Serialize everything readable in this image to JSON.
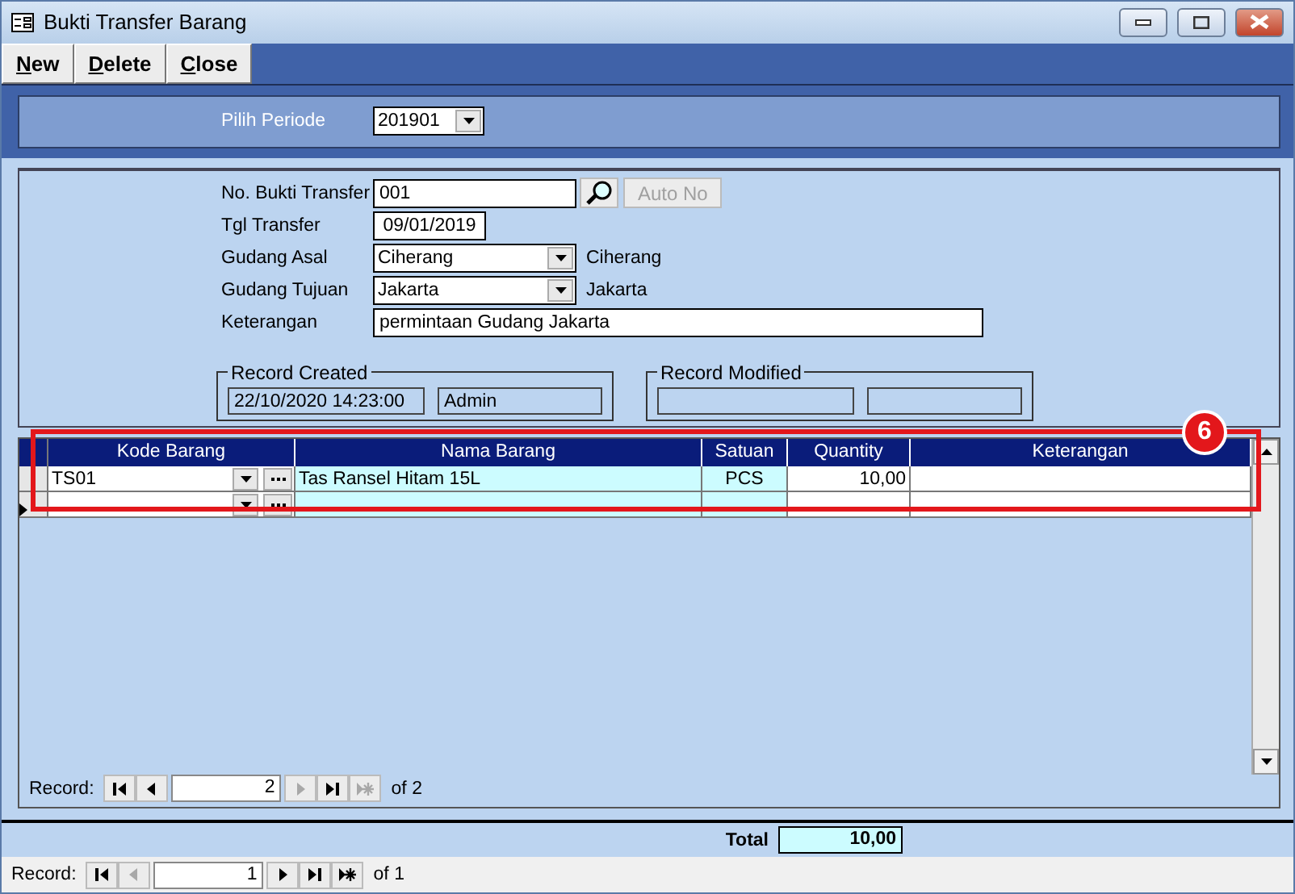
{
  "window": {
    "title": "Bukti Transfer Barang"
  },
  "toolbar": [
    {
      "label": "New"
    },
    {
      "label": "Delete"
    },
    {
      "label": "Close"
    }
  ],
  "period": {
    "label": "Pilih Periode",
    "value": "201901"
  },
  "form": {
    "fields": [
      {
        "kind": "lookup",
        "label": "No. Bukti Transfer",
        "value": "001",
        "button": "Auto No",
        "button_disabled": true
      },
      {
        "kind": "date",
        "label": "Tgl Transfer",
        "value": "09/01/2019"
      },
      {
        "kind": "combo",
        "label": "Gudang Asal",
        "value": "Ciherang",
        "note": "Ciherang"
      },
      {
        "kind": "combo",
        "label": "Gudang Tujuan",
        "value": "Jakarta",
        "note": "Jakarta"
      },
      {
        "kind": "text",
        "label": "Keterangan",
        "value": "permintaan Gudang Jakarta"
      }
    ],
    "groups": [
      {
        "title": "Record Created",
        "values": [
          "22/10/2020 14:23:00",
          "Admin"
        ]
      },
      {
        "title": "Record Modified"
      }
    ]
  },
  "table": {
    "columns": [
      "Kode Barang",
      "Nama Barang",
      "Satuan",
      "Quantity",
      "Keterangan"
    ],
    "rows": [
      {
        "current": false,
        "cells": [
          "TS01",
          "Tas Ransel Hitam 15L",
          "PCS",
          "10,00",
          ""
        ]
      },
      {
        "current": true,
        "cells": [
          "",
          "",
          "",
          "",
          ""
        ]
      }
    ],
    "navigator": {
      "label": "Record:",
      "value": "2",
      "of": "of  2",
      "disabled": [
        false,
        false,
        true,
        false,
        true
      ]
    }
  },
  "annotation": {
    "label": "6"
  },
  "total": {
    "label": "Total",
    "value": "10,00"
  },
  "navigator": {
    "label": "Record:",
    "value": "1",
    "of": "of  1",
    "disabled": [
      false,
      true,
      false,
      false,
      false
    ]
  }
}
